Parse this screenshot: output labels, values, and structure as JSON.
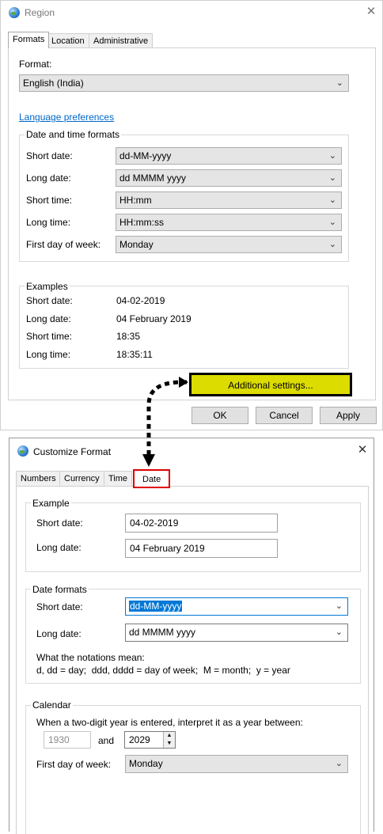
{
  "region": {
    "title": "Region",
    "close_glyph": "✕",
    "tabs": [
      "Formats",
      "Location",
      "Administrative"
    ],
    "format_label": "Format:",
    "format_value": "English (India)",
    "language_link": "Language preferences",
    "date_time_group": "Date and time formats",
    "fields": [
      {
        "label": "Short date:",
        "value": "dd-MM-yyyy"
      },
      {
        "label": "Long date:",
        "value": "dd MMMM yyyy"
      },
      {
        "label": "Short time:",
        "value": "HH:mm"
      },
      {
        "label": "Long time:",
        "value": "HH:mm:ss"
      },
      {
        "label": "First day of week:",
        "value": "Monday"
      }
    ],
    "examples_group": "Examples",
    "examples": [
      {
        "label": "Short date:",
        "value": "04-02-2019"
      },
      {
        "label": "Long date:",
        "value": "04 February 2019"
      },
      {
        "label": "Short time:",
        "value": "18:35"
      },
      {
        "label": "Long time:",
        "value": "18:35:11"
      }
    ],
    "additional_settings": "Additional settings...",
    "ok": "OK",
    "cancel": "Cancel",
    "apply": "Apply"
  },
  "customize": {
    "title": "Customize Format",
    "close_glyph": "✕",
    "tabs": [
      "Numbers",
      "Currency",
      "Time",
      "Date"
    ],
    "example_group": "Example",
    "example_short_label": "Short date:",
    "example_short_value": "04-02-2019",
    "example_long_label": "Long date:",
    "example_long_value": "04 February 2019",
    "date_formats_group": "Date formats",
    "short_date_label": "Short date:",
    "short_date_value": "dd-MM-yyyy",
    "long_date_label": "Long date:",
    "long_date_value": "dd MMMM yyyy",
    "notations_title": "What the notations mean:",
    "notations_text": "d, dd = day;  ddd, dddd = day of week;  M = month;  y = year",
    "calendar_group": "Calendar",
    "two_digit_text": "When a two-digit year is entered, interpret it as a year between:",
    "year_from": "1930",
    "and_label": "and",
    "year_to": "2029",
    "first_day_label": "First day of week:",
    "first_day_value": "Monday"
  },
  "colors": {
    "highlight_button": "#dcdc00",
    "annotation_red": "#e00000",
    "selection_blue": "#0078d7",
    "link_blue": "#0066cc"
  }
}
